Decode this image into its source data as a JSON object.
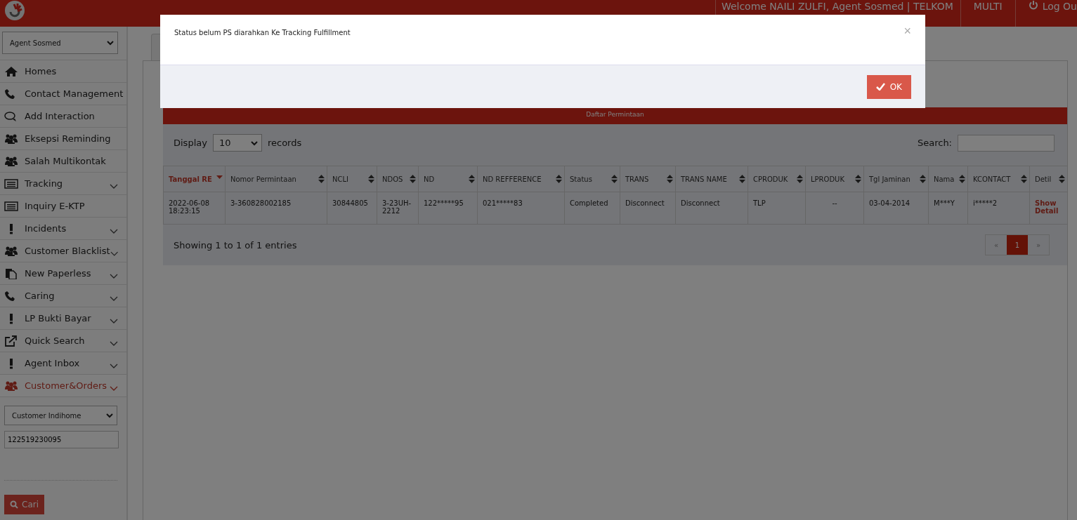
{
  "header": {
    "welcome": "Welcome NAILI ZULFI, Agent Sosmed | TELKOM",
    "mode": "MULTI",
    "logout": "Log Ou"
  },
  "sidebar": {
    "role_select": "Agent Sosmed",
    "items": [
      {
        "label": "Homes",
        "has_submenu": false,
        "selected": false
      },
      {
        "label": "Contact Management",
        "has_submenu": false,
        "selected": false
      },
      {
        "label": "Add Interaction",
        "has_submenu": false,
        "selected": false
      },
      {
        "label": "Eksepsi Reminding",
        "has_submenu": false,
        "selected": false
      },
      {
        "label": "Salah Multikontak",
        "has_submenu": false,
        "selected": false
      },
      {
        "label": "Tracking",
        "has_submenu": true,
        "selected": false
      },
      {
        "label": "Inquiry E-KTP",
        "has_submenu": false,
        "selected": false
      },
      {
        "label": "Incidents",
        "has_submenu": true,
        "selected": false
      },
      {
        "label": "Customer Blacklist",
        "has_submenu": true,
        "selected": false
      },
      {
        "label": "New Paperless",
        "has_submenu": true,
        "selected": false
      },
      {
        "label": "Caring",
        "has_submenu": true,
        "selected": false
      },
      {
        "label": "LP Bukti Bayar",
        "has_submenu": true,
        "selected": false
      },
      {
        "label": "Quick Search",
        "has_submenu": true,
        "selected": false
      },
      {
        "label": "Agent Inbox",
        "has_submenu": true,
        "selected": false
      },
      {
        "label": "Customer&Orders",
        "has_submenu": true,
        "selected": true
      }
    ],
    "customer_select": "Customer Indihome",
    "customer_input": "122519230095",
    "search_button": "Cari"
  },
  "panel": {
    "title": "Daftar Permintaan",
    "display_label": "Display",
    "display_value": "10",
    "records_label": "records",
    "search_label": "Search:",
    "table": {
      "columns": [
        {
          "label": "Tanggal RE",
          "sorted": true
        },
        {
          "label": "Nomor Permintaan",
          "sorted": false
        },
        {
          "label": "NCLI",
          "sorted": false
        },
        {
          "label": "NDOS",
          "sorted": false
        },
        {
          "label": "ND",
          "sorted": false
        },
        {
          "label": "ND REFFERENCE",
          "sorted": false
        },
        {
          "label": "Status",
          "sorted": false
        },
        {
          "label": "TRANS",
          "sorted": false
        },
        {
          "label": "TRANS NAME",
          "sorted": false
        },
        {
          "label": "CPRODUK",
          "sorted": false
        },
        {
          "label": "LPRODUK",
          "sorted": false
        },
        {
          "label": "Tgl Jaminan",
          "sorted": false
        },
        {
          "label": "Nama",
          "sorted": false
        },
        {
          "label": "KCONTACT",
          "sorted": false
        },
        {
          "label": "Detil",
          "sorted": false
        }
      ],
      "rows": [
        [
          "2022-06-08 18:23:15",
          "3-360828002185",
          "30844805",
          "3-23UH-2212",
          "122*****95",
          "021*****83",
          "Completed",
          "Disconnect",
          "Disconnect",
          "TLP",
          "--",
          "03-04-2014",
          "M***Y",
          "i*****2",
          "Show Detail"
        ]
      ]
    },
    "info": "Showing 1 to 1 of 1 entries",
    "pages": [
      {
        "label": "«",
        "selected": false
      },
      {
        "label": "1",
        "selected": true
      },
      {
        "label": "»",
        "selected": false
      }
    ]
  },
  "modal": {
    "message": "Status belum PS diarahkan Ke Tracking Fulfillment",
    "close": "×",
    "ok": "OK"
  }
}
